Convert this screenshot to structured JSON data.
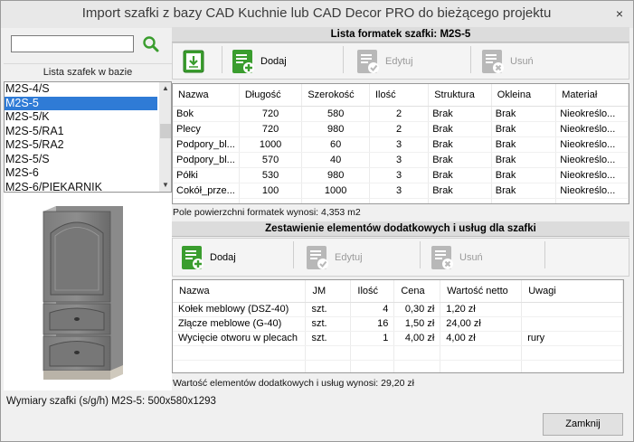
{
  "window": {
    "title": "Import szafki z bazy CAD Kuchnie lub CAD Decor PRO do bieżącego projektu",
    "close_label": "×"
  },
  "search": {
    "value": "",
    "placeholder": ""
  },
  "cabinet_list": {
    "header": "Lista szafek w bazie",
    "items": [
      "M2S-4/S",
      "M2S-5",
      "M2S-5/K",
      "M2S-5/RA1",
      "M2S-5/RA2",
      "M2S-5/S",
      "M2S-6",
      "M2S-6/PIEKARNIK"
    ],
    "selected": "M2S-5"
  },
  "formatki": {
    "title": "Lista formatek szafki: M2S-5",
    "toolbar": {
      "add_label": "Dodaj",
      "edit_label": "Edytuj",
      "delete_label": "Usuń"
    },
    "columns": [
      "Nazwa",
      "Długość",
      "Szerokość",
      "Ilość",
      "Struktura",
      "Okleina",
      "Materiał"
    ],
    "rows": [
      [
        "Bok",
        "720",
        "580",
        "2",
        "Brak",
        "Brak",
        "Nieokreślo..."
      ],
      [
        "Plecy",
        "720",
        "980",
        "2",
        "Brak",
        "Brak",
        "Nieokreślo..."
      ],
      [
        "Podpory_bl...",
        "1000",
        "60",
        "3",
        "Brak",
        "Brak",
        "Nieokreślo..."
      ],
      [
        "Podpory_bl...",
        "570",
        "40",
        "3",
        "Brak",
        "Brak",
        "Nieokreślo..."
      ],
      [
        "Półki",
        "530",
        "980",
        "3",
        "Brak",
        "Brak",
        "Nieokreślo..."
      ],
      [
        "Cokół_prze...",
        "100",
        "1000",
        "3",
        "Brak",
        "Brak",
        "Nieokreślo..."
      ]
    ],
    "area_text": "Pole powierzchni formatek wynosi: 4,353 m2"
  },
  "extras": {
    "title": "Zestawienie elementów dodatkowych i usług dla szafki",
    "toolbar": {
      "add_label": "Dodaj",
      "edit_label": "Edytuj",
      "delete_label": "Usuń"
    },
    "columns": [
      "Nazwa",
      "JM",
      "Ilość",
      "Cena",
      "Wartość netto",
      "Uwagi"
    ],
    "rows": [
      [
        "Kołek meblowy (DSZ-40)",
        "szt.",
        "4",
        "0,30 zł",
        "1,20 zł",
        ""
      ],
      [
        "Złącze meblowe (G-40)",
        "szt.",
        "16",
        "1,50 zł",
        "24,00 zł",
        ""
      ],
      [
        "Wycięcie otworu w plecach",
        "szt.",
        "1",
        "4,00 zł",
        "4,00 zł",
        "rury"
      ]
    ],
    "value_text": "Wartość elementów dodatkowych i usług wynosi: 29,20 zł"
  },
  "status": {
    "dimensions_text": "Wymiary szafki (s/g/h) M2S-5: 500x580x1293"
  },
  "close_button_label": "Zamknij",
  "icons": {
    "search": "magnifier-icon",
    "import": "download-icon",
    "add": "document-add-icon",
    "edit": "document-edit-icon",
    "delete": "document-delete-icon"
  },
  "colors": {
    "accent_green": "#3a9d2e",
    "selection_blue": "#2f7bd6"
  }
}
